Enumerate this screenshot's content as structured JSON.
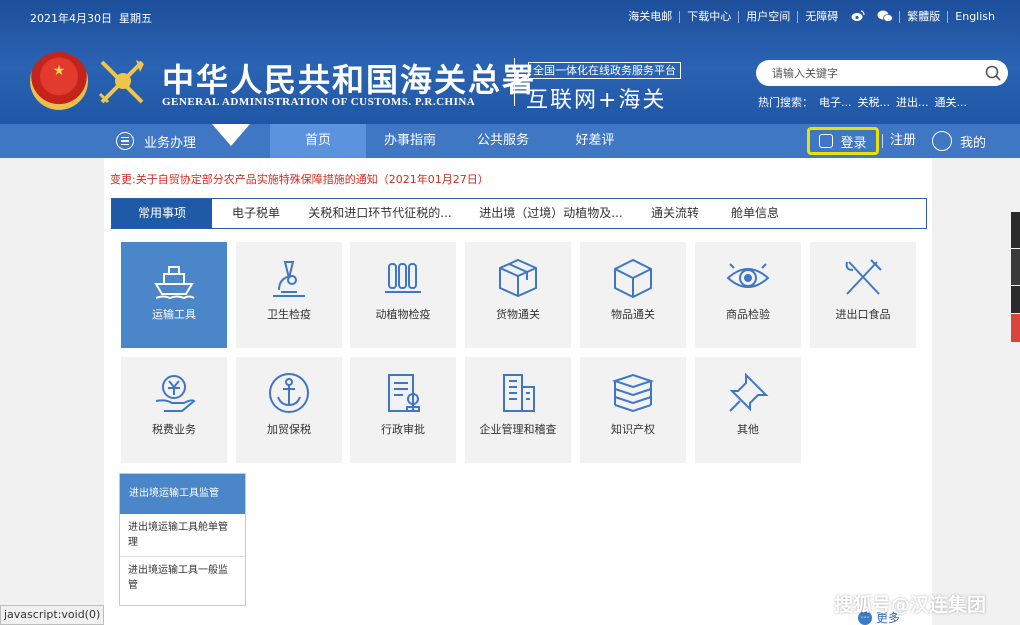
{
  "topbar": {
    "date": "2021年4月30日",
    "weekday": "星期五",
    "links": [
      "海关电邮",
      "下载中心",
      "用户空间",
      "无障碍"
    ],
    "social_icons": [
      "weibo-icon",
      "wechat-icon"
    ],
    "trad": "繁體版",
    "english": "English"
  },
  "brand": {
    "title_cn": "中华人民共和国海关总署",
    "title_en": "GENERAL ADMINISTRATION OF CUSTOMS. P.R.CHINA",
    "platform": "全国一体化在线政务服务平台",
    "platform_name": "互联网+海关"
  },
  "search": {
    "placeholder": "请输入关键字",
    "hot_label": "热门搜索：",
    "hot_items": [
      "电子...",
      "关税...",
      "进出...",
      "通关..."
    ]
  },
  "nav": {
    "business": "业务办理",
    "tabs": [
      "首页",
      "办事指南",
      "公共服务",
      "好差评"
    ],
    "active_tab": "首页",
    "login": "登录",
    "register": "注册",
    "mine": "我的"
  },
  "notice": "变更:关于自贸协定部分农产品实施特殊保障措施的通知（2021年01月27日）",
  "category_tabs": [
    "常用事项",
    "电子税单",
    "关税和进口环节代征税的...",
    "进出境（过境）动植物及...",
    "通关流转",
    "舱单信息"
  ],
  "tiles": [
    {
      "label": "运输工具",
      "icon": "ship-icon",
      "active": true
    },
    {
      "label": "卫生检疫",
      "icon": "microscope-icon"
    },
    {
      "label": "动植物检疫",
      "icon": "cage-icon"
    },
    {
      "label": "货物通关",
      "icon": "box-icon"
    },
    {
      "label": "物品通关",
      "icon": "cube-icon"
    },
    {
      "label": "商品检验",
      "icon": "eye-icon"
    },
    {
      "label": "进出口食品",
      "icon": "fork-knife-icon"
    },
    {
      "label": "税费业务",
      "icon": "yuan-hand-icon"
    },
    {
      "label": "加贸保税",
      "icon": "anchor-icon"
    },
    {
      "label": "行政审批",
      "icon": "document-stamp-icon"
    },
    {
      "label": "企业管理和稽查",
      "icon": "building-icon"
    },
    {
      "label": "知识产权",
      "icon": "books-icon"
    },
    {
      "label": "其他",
      "icon": "pin-icon"
    }
  ],
  "submenu": {
    "title": "进出境运输工具监管",
    "items": [
      "进出境运输工具舱单管理",
      "进出境运输工具一般监管"
    ]
  },
  "more": "更多",
  "statusbar": "javascript:void(0)",
  "watermark": "搜狐号@汉连集团",
  "colors": {
    "header": "#1d4f9b",
    "nav": "#3f77c4",
    "active_tile": "#4a86c8",
    "highlight": "#e8e200",
    "notice": "#d42b1e"
  }
}
